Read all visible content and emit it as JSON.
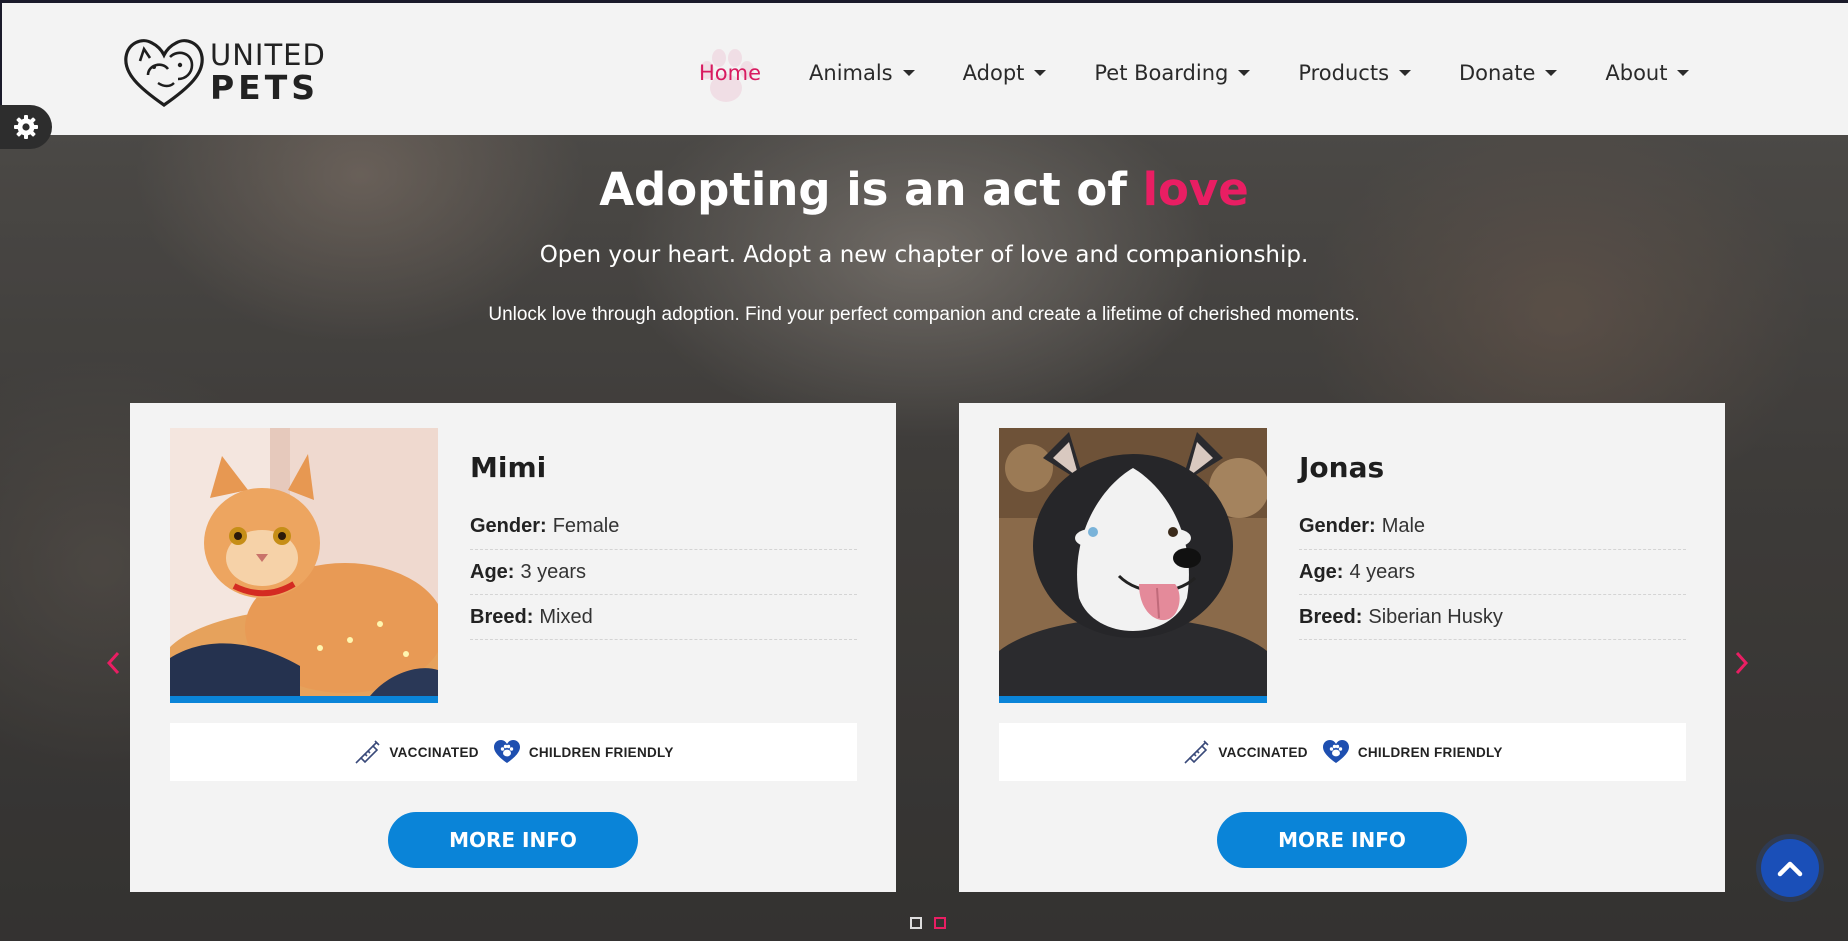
{
  "brand": {
    "line1": "UNITED",
    "line2": "PETS"
  },
  "nav": {
    "items": [
      {
        "label": "Home",
        "active": true,
        "dropdown": false
      },
      {
        "label": "Animals",
        "dropdown": true
      },
      {
        "label": "Adopt",
        "dropdown": true
      },
      {
        "label": "Pet Boarding",
        "dropdown": true
      },
      {
        "label": "Products",
        "dropdown": true
      },
      {
        "label": "Donate",
        "dropdown": true
      },
      {
        "label": "About",
        "dropdown": true
      }
    ]
  },
  "hero": {
    "title_main": "Adopting is an act of",
    "title_accent": "love",
    "subtitle": "Open your heart. Adopt a new chapter of love and companionship.",
    "description": "Unlock love through adoption. Find your perfect companion and create a lifetime of cherished moments."
  },
  "pets": [
    {
      "name": "Mimi",
      "gender_label": "Gender:",
      "gender": "Female",
      "age_label": "Age:",
      "age": "3 years",
      "breed_label": "Breed:",
      "breed": "Mixed",
      "features": [
        "VACCINATED",
        "CHILDREN FRIENDLY"
      ],
      "button": "MORE INFO",
      "photo_icon": "cat-photo"
    },
    {
      "name": "Jonas",
      "gender_label": "Gender:",
      "gender": "Male",
      "age_label": "Age:",
      "age": "4 years",
      "breed_label": "Breed:",
      "breed": "Siberian Husky",
      "features": [
        "VACCINATED",
        "CHILDREN FRIENDLY"
      ],
      "button": "MORE INFO",
      "photo_icon": "husky-photo"
    }
  ],
  "carousel": {
    "slides": 2,
    "active_slide": 2
  },
  "colors": {
    "accent": "#e91e63",
    "primary": "#0a84d8",
    "scroll_top": "#1a4fb8"
  }
}
